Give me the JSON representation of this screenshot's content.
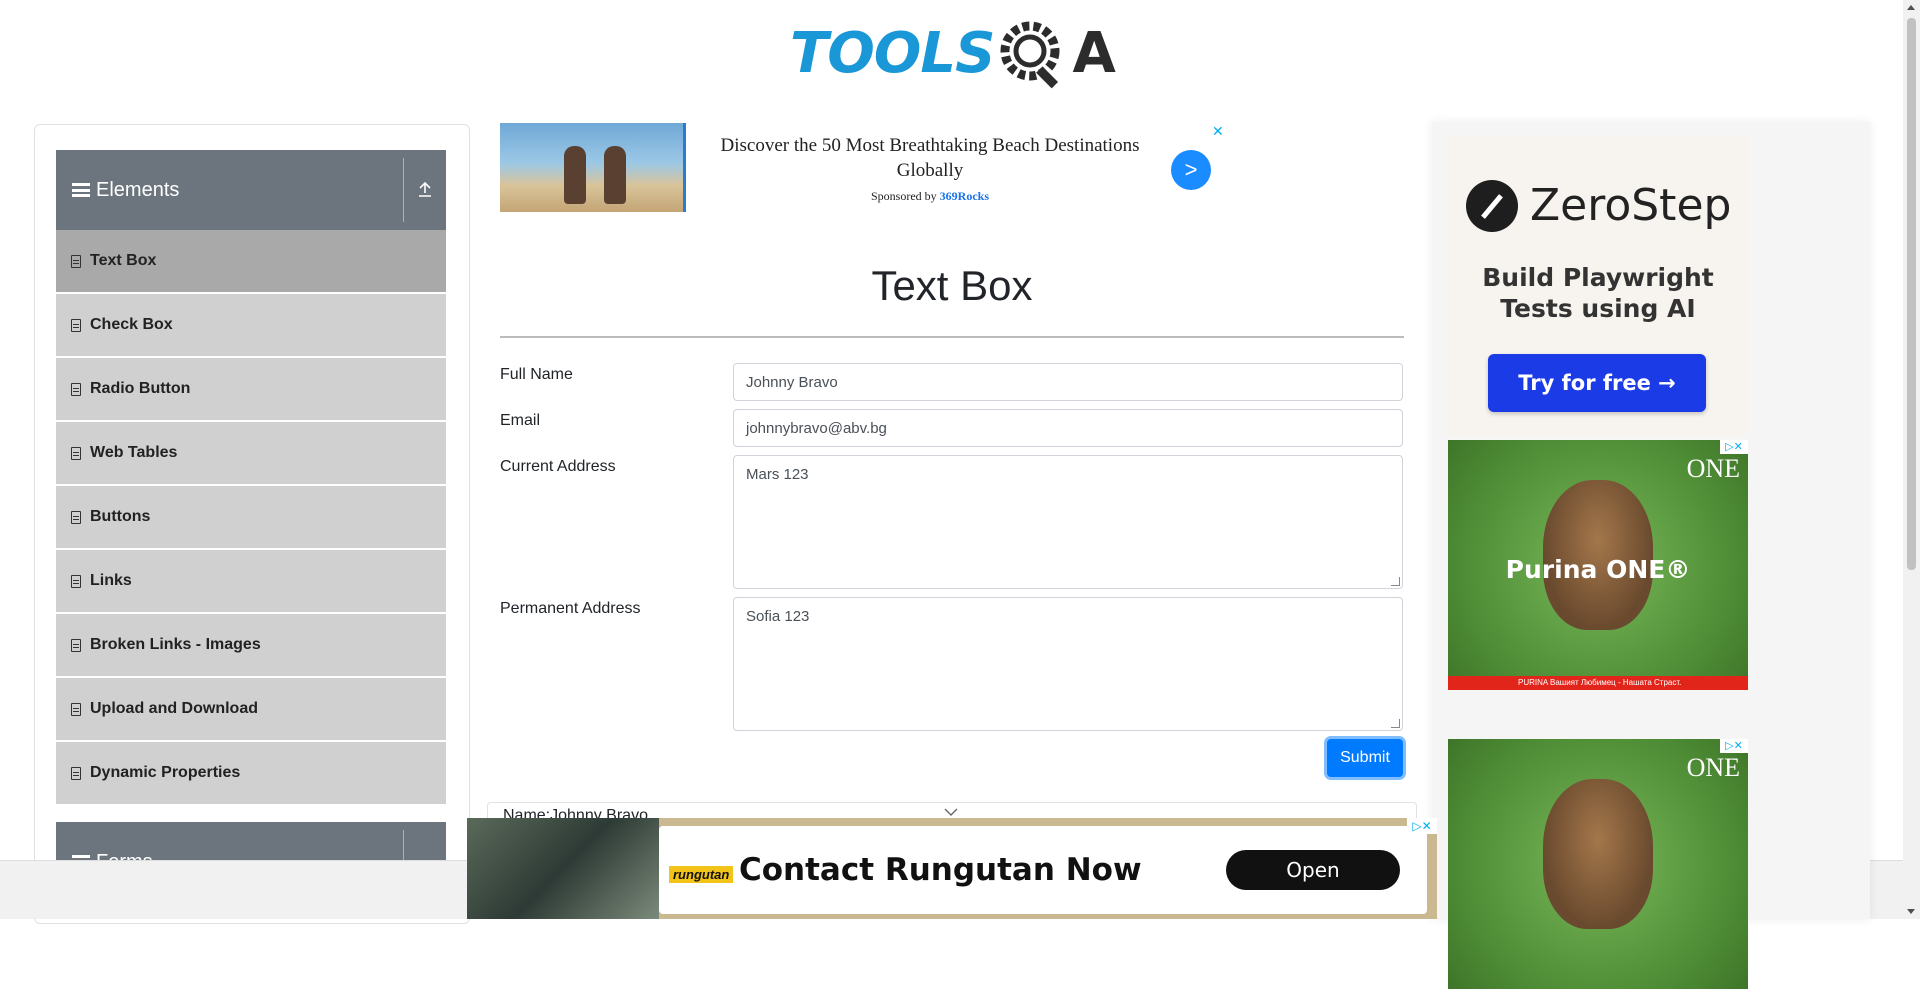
{
  "header": {
    "logo_text": "TOOLS",
    "logo_a": "A"
  },
  "sidebar": {
    "group_elements": "Elements",
    "group_forms": "Forms",
    "items": [
      {
        "label": "Text Box"
      },
      {
        "label": "Check Box"
      },
      {
        "label": "Radio Button"
      },
      {
        "label": "Web Tables"
      },
      {
        "label": "Buttons"
      },
      {
        "label": "Links"
      },
      {
        "label": "Broken Links - Images"
      },
      {
        "label": "Upload and Download"
      },
      {
        "label": "Dynamic Properties"
      }
    ]
  },
  "ad_top": {
    "title": "Discover the 50 Most Breathtaking Beach Destinations Globally",
    "sponsored_prefix": "Sponsored by",
    "sponsor": "369Rocks",
    "go": ">",
    "close": "✕"
  },
  "form": {
    "title": "Text Box",
    "full_name_label": "Full Name",
    "full_name_value": "Johnny Bravo",
    "email_label": "Email",
    "email_value": "johnnybravo@abv.bg",
    "current_address_label": "Current Address",
    "current_address_value": "Mars 123",
    "permanent_address_label": "Permanent Address",
    "permanent_address_value": "Sofia 123",
    "submit_label": "Submit"
  },
  "output": {
    "name_line": "Name:Johnny Bravo"
  },
  "right_ad": {
    "brand": "ZeroStep",
    "tagline_1": "Build Playwright",
    "tagline_2": "Tests using AI",
    "cta": "Try for free →",
    "purina_one": "ONE",
    "purina_name": "Purina ONE®",
    "purina_bar": "PURINA  Вашият Любимец - Нашата Страст."
  },
  "ad_bottom": {
    "brand": "rungutan",
    "text": "Contact Rungutan Now",
    "cta": "Open",
    "close": "▷✕"
  },
  "colors": {
    "accent": "#007bff",
    "sidebar_header": "#6c757d",
    "menu_item": "#d0d0d0",
    "menu_item_active": "#a9a9a9",
    "logo_blue": "#1a97d6"
  }
}
